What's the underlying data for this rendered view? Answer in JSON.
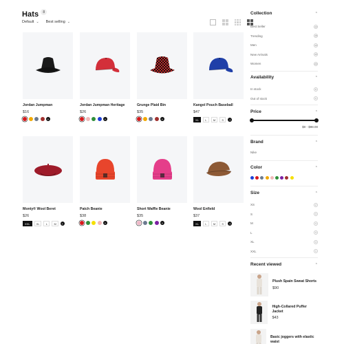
{
  "header": {
    "title": "Hats",
    "count": "8"
  },
  "sort": {
    "filter_label": "Default",
    "sort_label": "Best selling"
  },
  "icons": {
    "caret": "chevron-down-icon",
    "view": [
      "list-view-icon",
      "grid-2-icon",
      "grid-3-icon",
      "grid-4-icon"
    ]
  },
  "products": [
    {
      "name": "Jordan Jumpman",
      "price": "$16",
      "hat": "bucket",
      "color": "#1a1a1a",
      "swatches": [
        "#d7191c",
        "#f2a900",
        "#6b7a8f",
        "#a0302e"
      ],
      "sizes": []
    },
    {
      "name": "Jordan Jumpman Heritage",
      "price": "$26",
      "hat": "cap",
      "color": "#d32f3a",
      "swatches": [
        "#d7191c",
        "#f0b8b8",
        "#2f8f3a",
        "#1c3fd6"
      ],
      "sizes": []
    },
    {
      "name": "Grunge Plaid Bin",
      "price": "$35",
      "hat": "plaid",
      "color": "#c62828",
      "swatches": [
        "#d7191c",
        "#f2a900",
        "#6b7a8f",
        "#a0302e"
      ],
      "sizes": []
    },
    {
      "name": "Kangol Pouch Baseball",
      "price": "$47",
      "hat": "cap",
      "color": "#1f3fa8",
      "swatches": [],
      "sizes": [
        "XL",
        "L",
        "M",
        "S"
      ]
    },
    {
      "name": "Monty® Wool Beret",
      "price": "$26",
      "hat": "beret",
      "color": "#9e1b2a",
      "swatches": [],
      "sizes": [
        "XXL",
        "XL",
        "L",
        "M"
      ]
    },
    {
      "name": "Patch Beanie",
      "price": "$38",
      "hat": "beanie",
      "color": "#e8452c",
      "swatches": [
        "#d7191c",
        "#2f8f3a",
        "#f5e000",
        "#f0b8b8"
      ],
      "sizes": []
    },
    {
      "name": "Short Waffle Beanie",
      "price": "$35",
      "hat": "beanie",
      "color": "#e53e8a",
      "swatches": [
        "#f0b8c8",
        "#6b7a8f",
        "#2f8f3a",
        "#7b1fa2"
      ],
      "sizes": []
    },
    {
      "name": "Wool Enfield",
      "price": "$37",
      "hat": "flatcap",
      "color": "#8d5a36",
      "swatches": [],
      "sizes": [
        "XL",
        "L",
        "M",
        "S"
      ]
    }
  ],
  "sidebar": {
    "collection": {
      "title": "Collection",
      "items": [
        {
          "label": "Best Seller",
          "count": "12"
        },
        {
          "label": "Trending",
          "count": "18"
        },
        {
          "label": "Men",
          "count": "10"
        },
        {
          "label": "New Arrivals",
          "count": "15"
        },
        {
          "label": "Women",
          "count": "20"
        }
      ]
    },
    "availability": {
      "title": "Availability",
      "items": [
        {
          "label": "In stock",
          "count": "8"
        },
        {
          "label": "Out of stock",
          "count": "0"
        }
      ]
    },
    "price": {
      "title": "Price",
      "min": 0,
      "max": 98,
      "range_label": "$0 - $98.00"
    },
    "brand": {
      "title": "Brand",
      "items": [
        {
          "label": "Nike"
        }
      ]
    },
    "color": {
      "title": "Color",
      "swatches": [
        "#1c3fd6",
        "#d7191c",
        "#6b7a8f",
        "#f2a900",
        "#f0b8b8",
        "#2f8f3a",
        "#7b1fa2",
        "#a0302e",
        "#f5e000"
      ]
    },
    "size": {
      "title": "Size",
      "items": [
        {
          "label": "XS",
          "count": "2"
        },
        {
          "label": "S",
          "count": "3"
        },
        {
          "label": "M",
          "count": "3"
        },
        {
          "label": "L",
          "count": "3"
        },
        {
          "label": "XL",
          "count": "3"
        },
        {
          "label": "XXL",
          "count": "1"
        }
      ]
    },
    "recent": {
      "title": "Recent viewed",
      "items": [
        {
          "name": "Plush Spain Sweat Shorts",
          "price": "$90"
        },
        {
          "name": "High-Collared Puffer Jacket",
          "price": "$43"
        },
        {
          "name": "Basic joggers with elastic waist",
          "price": ""
        }
      ]
    }
  }
}
